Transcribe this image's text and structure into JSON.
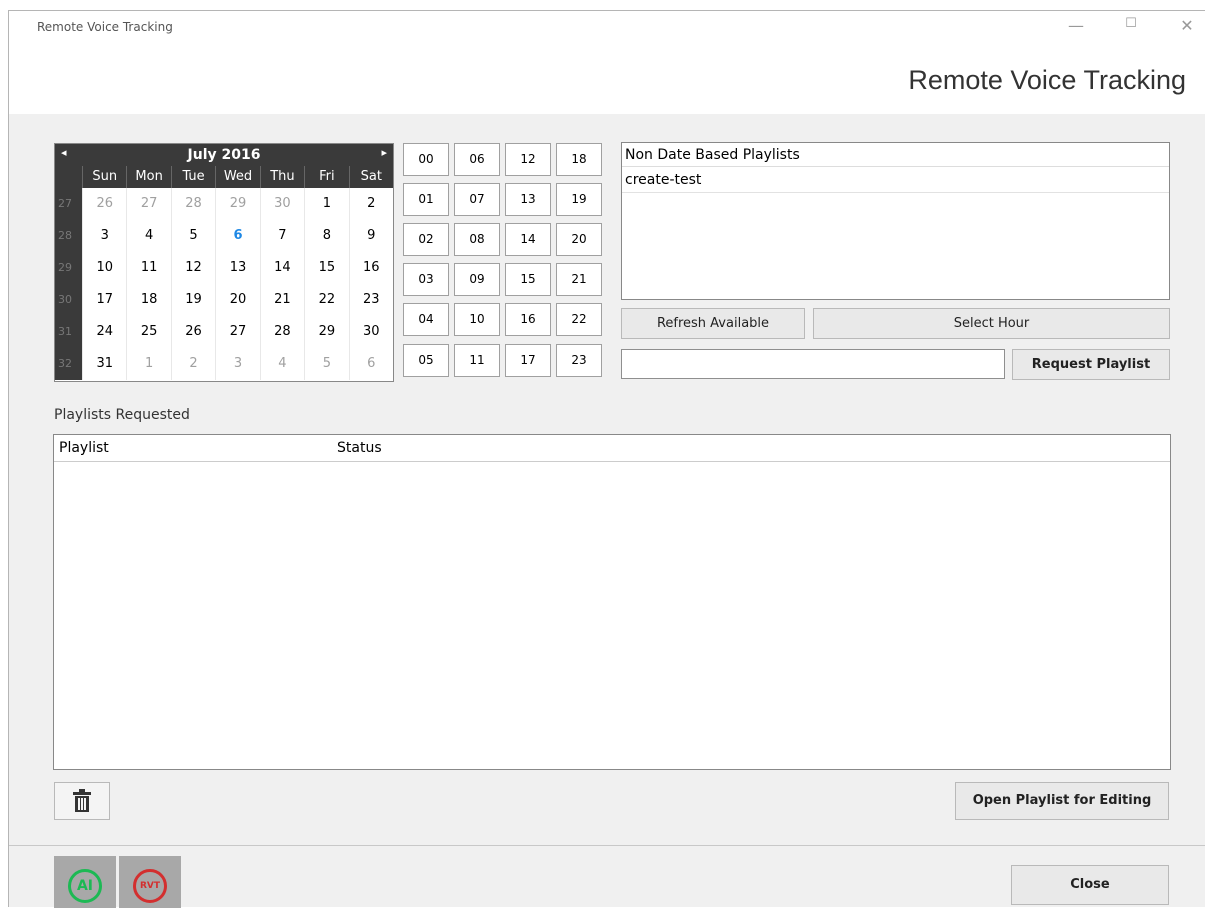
{
  "window": {
    "title": "Remote Voice Tracking",
    "heading": "Remote Voice Tracking",
    "minimize_glyph": "—",
    "maximize_glyph": "☐",
    "close_glyph": "✕"
  },
  "calendar": {
    "month_label": "July 2016",
    "prev_glyph": "◂",
    "next_glyph": "▸",
    "weekdays": [
      "Sun",
      "Mon",
      "Tue",
      "Wed",
      "Thu",
      "Fri",
      "Sat"
    ],
    "weeks": [
      {
        "num": "27",
        "days": [
          "26",
          "27",
          "28",
          "29",
          "30",
          "1",
          "2"
        ]
      },
      {
        "num": "28",
        "days": [
          "3",
          "4",
          "5",
          "6",
          "7",
          "8",
          "9"
        ]
      },
      {
        "num": "29",
        "days": [
          "10",
          "11",
          "12",
          "13",
          "14",
          "15",
          "16"
        ]
      },
      {
        "num": "30",
        "days": [
          "17",
          "18",
          "19",
          "20",
          "21",
          "22",
          "23"
        ]
      },
      {
        "num": "31",
        "days": [
          "24",
          "25",
          "26",
          "27",
          "28",
          "29",
          "30"
        ]
      },
      {
        "num": "32",
        "days": [
          "31",
          "1",
          "2",
          "3",
          "4",
          "5",
          "6"
        ]
      }
    ],
    "other_month": [
      [
        0,
        0
      ],
      [
        0,
        1
      ],
      [
        0,
        2
      ],
      [
        0,
        3
      ],
      [
        0,
        4
      ],
      [
        5,
        1
      ],
      [
        5,
        2
      ],
      [
        5,
        3
      ],
      [
        5,
        4
      ],
      [
        5,
        5
      ],
      [
        5,
        6
      ]
    ],
    "today": [
      1,
      3
    ],
    "today_color": "#1e88e5"
  },
  "hours": [
    "00",
    "01",
    "02",
    "03",
    "04",
    "05",
    "06",
    "07",
    "08",
    "09",
    "10",
    "11",
    "12",
    "13",
    "14",
    "15",
    "16",
    "17",
    "18",
    "19",
    "20",
    "21",
    "22",
    "23"
  ],
  "non_date_playlists": {
    "header": "Non Date Based Playlists",
    "items": [
      "create-test"
    ]
  },
  "buttons": {
    "refresh": "Refresh Available",
    "select_hour": "Select Hour",
    "request": "Request Playlist",
    "open_edit": "Open Playlist for Editing",
    "close": "Close",
    "delete_icon": "trash-icon"
  },
  "request_input": {
    "value": ""
  },
  "requested": {
    "label": "Playlists Requested",
    "columns": [
      "Playlist",
      "Status"
    ]
  },
  "badges": [
    {
      "text": "AI",
      "color": "#1db954"
    },
    {
      "text": "RVT",
      "color": "#d32f2f"
    }
  ]
}
